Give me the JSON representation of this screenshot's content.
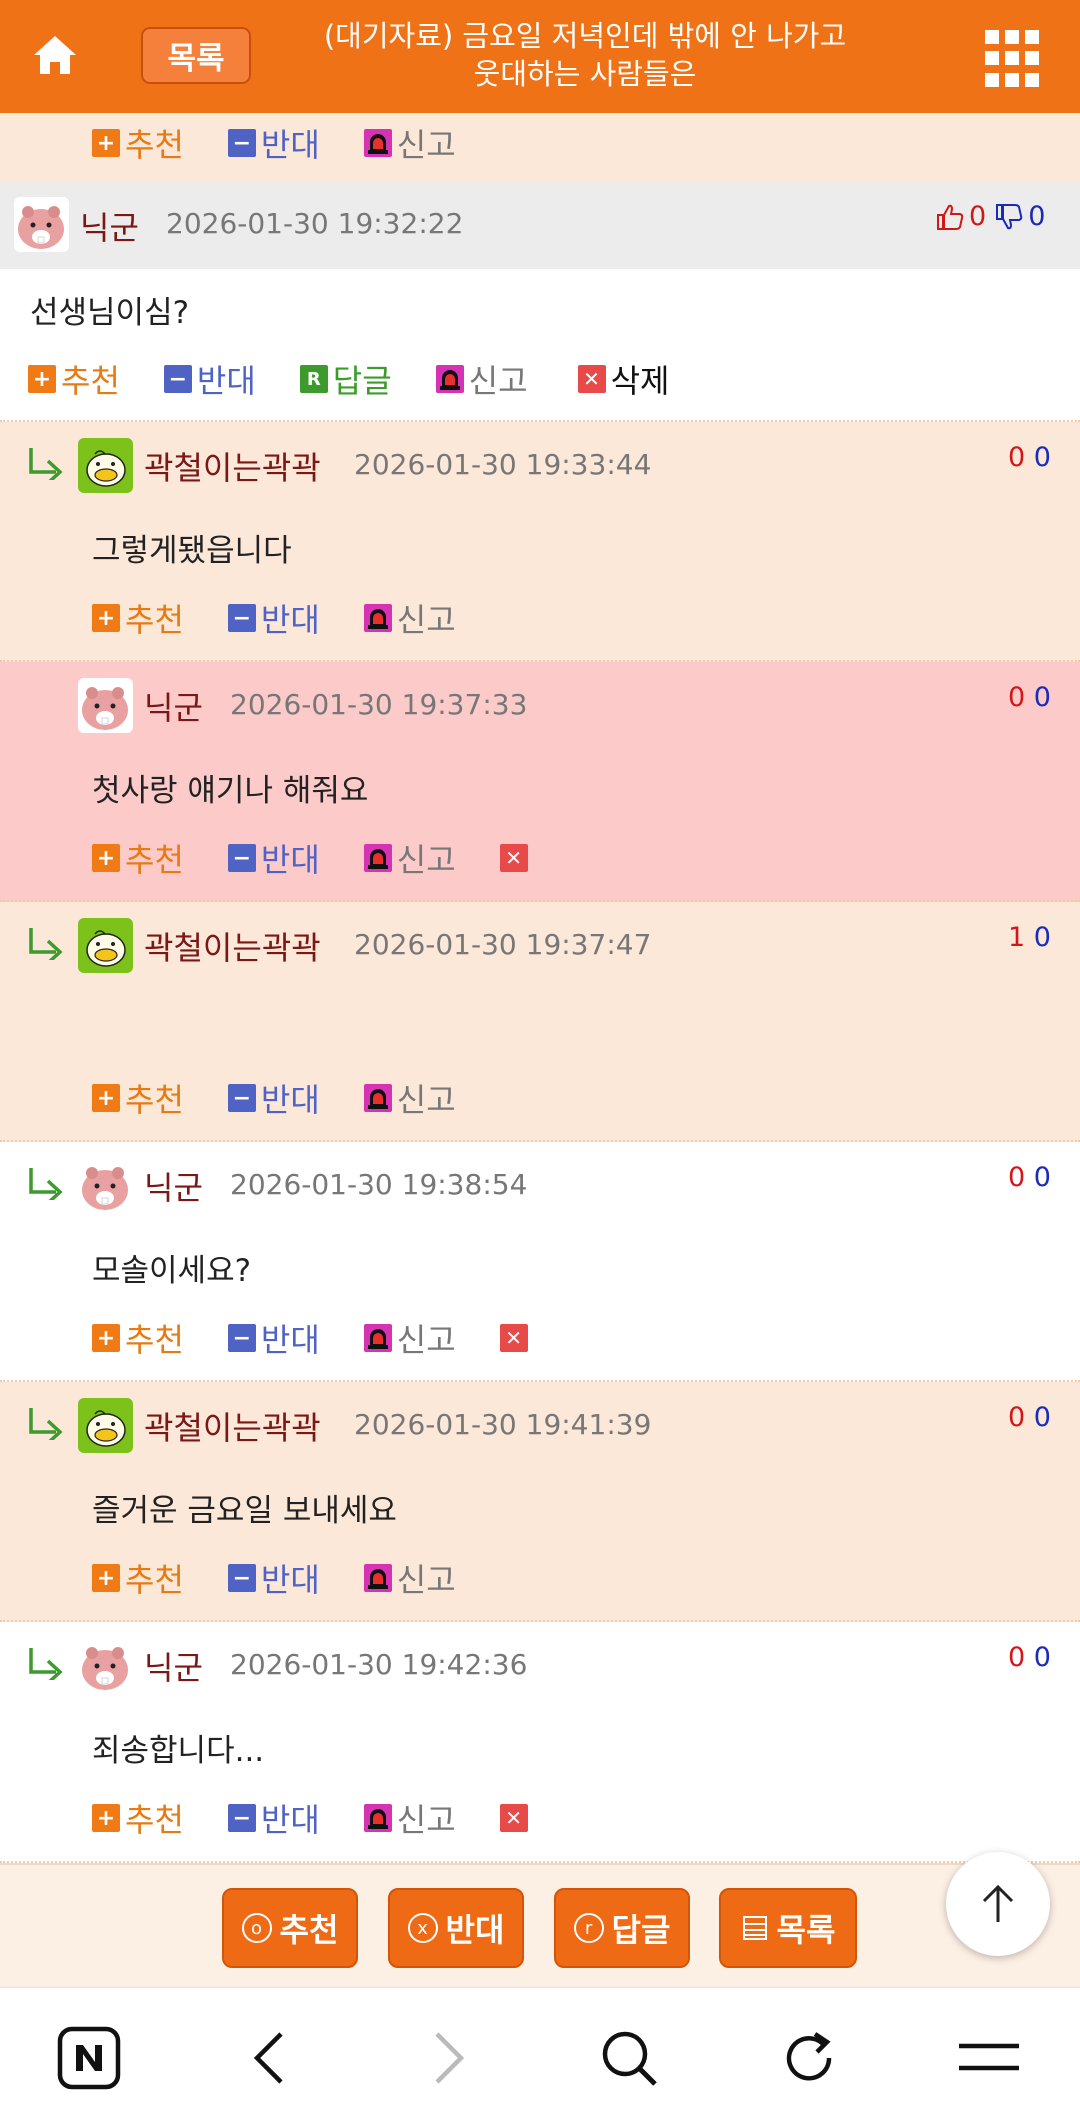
{
  "header": {
    "list_label": "목록",
    "title_line1": "(대기자료) 금요일 저녁인데 밖에 안 나가고",
    "title_line2": "웃대하는 사람들은"
  },
  "icons": {
    "home": "home-icon",
    "menu": "grid-menu-icon",
    "reply": "reply-arrow-icon",
    "thumbs_up": "thumbs-up-icon",
    "thumbs_down": "thumbs-down-icon",
    "report": "siren-icon",
    "delete": "close-icon",
    "scroll_top": "arrow-up-icon"
  },
  "colors": {
    "accent": "#f07216",
    "vote_up": "#d01818",
    "vote_down": "#1a2bb8"
  },
  "labels": {
    "recommend": "추천",
    "oppose": "반대",
    "reply": "답글",
    "report": "신고",
    "delete": "삭제"
  },
  "top_partial_actions": [
    "추천",
    "반대",
    "신고"
  ],
  "comments": [
    {
      "author": "닉군",
      "date": "2026-01-30 19:32:22",
      "text": "선생님이심?",
      "up": "0",
      "down": "0"
    },
    {
      "author": "곽철이는곽곽",
      "date": "2026-01-30 19:33:44",
      "text": "그렇게됐읍니다",
      "up": "0",
      "down": "0"
    },
    {
      "author": "닉군",
      "date": "2026-01-30 19:37:33",
      "text": "첫사랑 얘기나 해줘요",
      "up": "0",
      "down": "0"
    },
    {
      "author": "곽철이는곽곽",
      "date": "2026-01-30 19:37:47",
      "text": "",
      "up": "1",
      "down": "0"
    },
    {
      "author": "닉군",
      "date": "2026-01-30 19:38:54",
      "text": "모솔이세요?",
      "up": "0",
      "down": "0"
    },
    {
      "author": "곽철이는곽곽",
      "date": "2026-01-30 19:41:39",
      "text": "즐거운 금요일 보내세요",
      "up": "0",
      "down": "0"
    },
    {
      "author": "닉군",
      "date": "2026-01-30 19:42:36",
      "text": "죄송합니다...",
      "up": "0",
      "down": "0"
    }
  ],
  "bottom_bar": {
    "recommend": "추천",
    "recommend_mark": "o",
    "oppose": "반대",
    "oppose_mark": "x",
    "reply": "답글",
    "reply_mark": "r",
    "list": "목록"
  }
}
